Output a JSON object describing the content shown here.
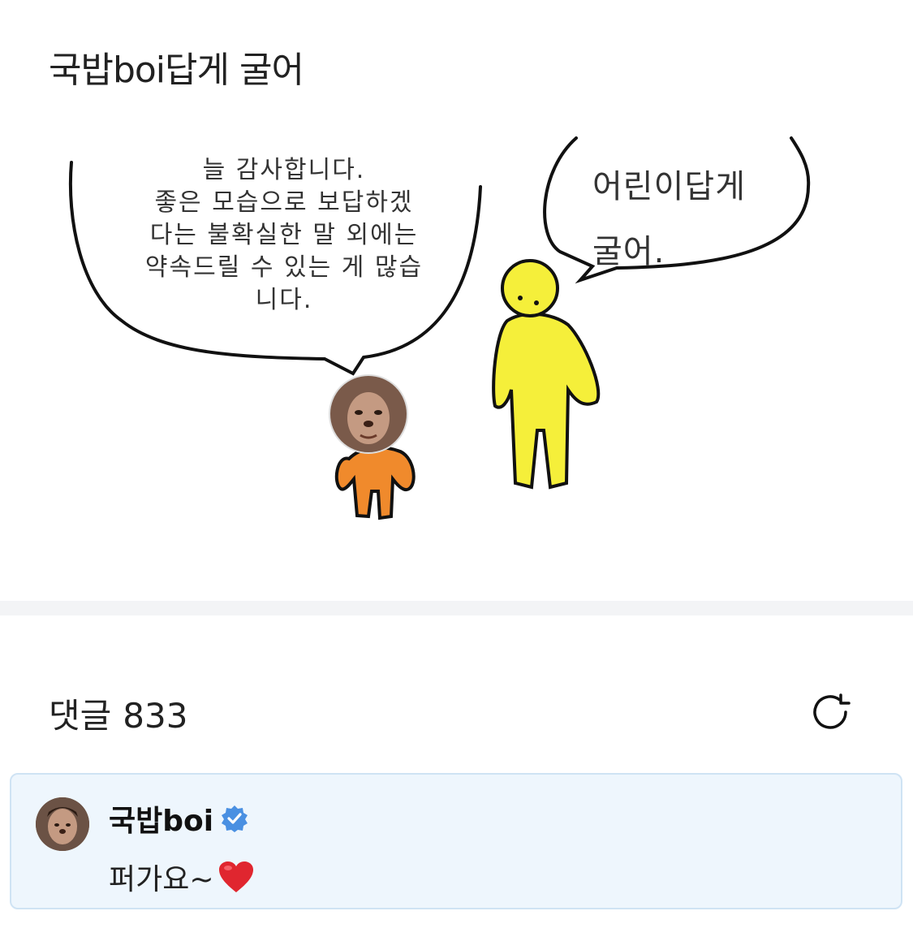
{
  "post": {
    "title": "국밥boi답게 굴어"
  },
  "comic": {
    "left_bubble_lines": [
      "늘 감사합니다.",
      "좋은 모습으로 보답하겠",
      "다는 불확실한 말 외에는",
      "약속드릴 수 있는 게 많습",
      "니다."
    ],
    "right_bubble_lines": [
      "어린이답게",
      "굴어."
    ],
    "colors": {
      "orange_figure": "#f08a2c",
      "yellow_figure": "#f5ef3a",
      "outline": "#111111"
    }
  },
  "comments": {
    "label": "댓글",
    "count": "833",
    "refresh_icon": "refresh-icon"
  },
  "comment": {
    "author": "국밥boi",
    "verified_icon": "verified-badge-icon",
    "text": "퍼가요~",
    "emoji_icon": "heart-icon",
    "card_bg": "#eef6fd",
    "verified_color": "#4a90e2"
  }
}
